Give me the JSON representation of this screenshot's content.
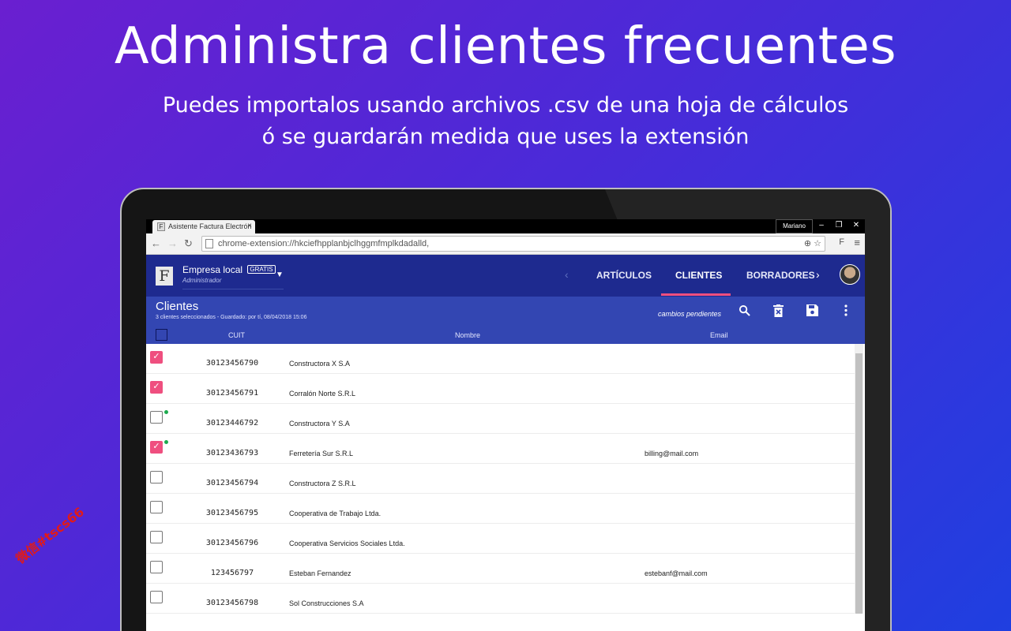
{
  "headline": "Administra clientes frecuentes",
  "subtitle_line1": "Puedes importalos usando archivos .csv de una hoja de cálculos",
  "subtitle_line2": "ó se guardarán medida que uses la extensión",
  "browser": {
    "tab_title": "Asistente Factura Electrón",
    "tab_close": "×",
    "user": "Mariano",
    "url": "chrome-extension://hkciefhpplanbjclhggmfmplkdadalld,",
    "window_controls": [
      "–",
      "❐",
      "✕"
    ]
  },
  "app": {
    "logo": "F",
    "company": "Empresa local",
    "badge": "GRATIS",
    "role": "Administrador",
    "tabs": [
      "ARTÍCULOS",
      "CLIENTES",
      "BORRADORES"
    ],
    "active_tab": "CLIENTES",
    "colors": {
      "header": "#1e2a8f",
      "toolbar": "#3346b2",
      "accent": "#ef4f7f",
      "status_dot": "#1caa4e"
    }
  },
  "toolbar": {
    "title": "Clientes",
    "status": "3 clientes seleccionados - Guardado: por tí, 08/04/2018 15:06",
    "pending": "cambios pendientes",
    "icons": [
      "search-icon",
      "delete-icon",
      "save-icon",
      "more-vert-icon"
    ]
  },
  "table": {
    "headers": {
      "cuit": "CUIT",
      "nombre": "Nombre",
      "email": "Email"
    },
    "rows": [
      {
        "checked": true,
        "dot": false,
        "cuit": "30123456790",
        "nombre": "Constructora X S.A",
        "email": ""
      },
      {
        "checked": true,
        "dot": false,
        "cuit": "30123456791",
        "nombre": "Corralón Norte S.R.L",
        "email": ""
      },
      {
        "checked": false,
        "dot": true,
        "cuit": "30123446792",
        "nombre": "Constructora Y S.A",
        "email": ""
      },
      {
        "checked": true,
        "dot": true,
        "cuit": "30123436793",
        "nombre": "Ferretería Sur S.R.L",
        "email": "billing@mail.com"
      },
      {
        "checked": false,
        "dot": false,
        "cuit": "30123456794",
        "nombre": "Constructora Z S.R.L",
        "email": ""
      },
      {
        "checked": false,
        "dot": false,
        "cuit": "30123456795",
        "nombre": "Cooperativa de Trabajo Ltda.",
        "email": ""
      },
      {
        "checked": false,
        "dot": false,
        "cuit": "30123456796",
        "nombre": "Cooperativa Servicios Sociales Ltda.",
        "email": ""
      },
      {
        "checked": false,
        "dot": false,
        "cuit": "123456797",
        "nombre": "Esteban Fernandez",
        "email": "estebanf@mail.com"
      },
      {
        "checked": false,
        "dot": false,
        "cuit": "30123456798",
        "nombre": "Sol Construcciones S.A",
        "email": ""
      }
    ]
  },
  "watermark": "微信#tscs66"
}
